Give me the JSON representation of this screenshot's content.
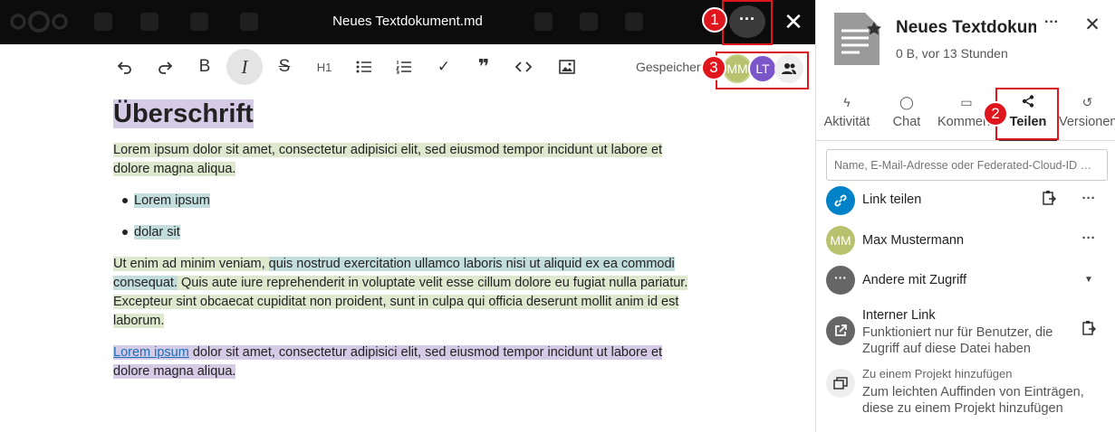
{
  "viewer": {
    "document_title": "Neues Textdokument.md",
    "more_label": "···",
    "close_label": "✕"
  },
  "toolbar": {
    "undo": "↶",
    "redo": "↷",
    "bold": "B",
    "italic": "I",
    "strike": "S",
    "heading": "H1",
    "bullet_list": "☰",
    "ordered_list": "≡",
    "checkbox": "✓",
    "quote": "❞",
    "code": "‹›",
    "image": "▣",
    "saved_status": "Gespeichert",
    "avatars": [
      {
        "initials": "MM",
        "color": "#b7c26e"
      },
      {
        "initials": "LT",
        "color": "#7b56c8"
      }
    ]
  },
  "document": {
    "heading": "Überschrift",
    "paragraph1": "Lorem ipsum dolor sit amet, consectetur adipisici elit, sed eiusmod tempor incidunt ut labore et dolore magna aliqua.",
    "list": [
      "Lorem ipsum",
      "dolar sit"
    ],
    "paragraph2_a": "Ut enim ad minim veniam, ",
    "paragraph2_b": "quis nostrud exercitation ullamco laboris nisi ut aliquid ex ea commodi consequat.",
    "paragraph2_c": " Quis aute iure reprehenderit in voluptate velit esse cillum dolore eu fugiat nulla pariatur. Excepteur sint obcaecat cupiditat non proident, sunt in culpa qui officia deserunt mollit anim id est laborum.",
    "paragraph3_link": "Lorem ipsum",
    "paragraph3_rest": " dolor sit amet, consectetur adipisici elit, sed eiusmod tempor incidunt ut labore et dolore magna aliqua."
  },
  "sidebar": {
    "file_name": "Neues Textdokument.md",
    "file_meta": "0 B, vor 13 Stunden",
    "more_label": "···",
    "close_label": "✕",
    "tabs": [
      {
        "icon": "ϟ",
        "label": "Aktivität"
      },
      {
        "icon": "◯",
        "label": "Chat"
      },
      {
        "icon": "▭",
        "label": "Kommentare"
      },
      {
        "icon": "<",
        "label": "Teilen",
        "active": true
      },
      {
        "icon": "↺",
        "label": "Versionen"
      }
    ],
    "share_placeholder": "Name, E-Mail-Adresse oder Federated-Cloud-ID …",
    "link_share": "Link teilen",
    "user": {
      "initials": "MM",
      "name": "Max Mustermann"
    },
    "others_access": "Andere mit Zugriff",
    "internal_link": {
      "title": "Interner Link",
      "desc": "Funktioniert nur für Benutzer, die Zugriff auf diese Datei haben"
    },
    "project": {
      "title": "Zu einem Projekt hinzufügen",
      "desc": "Zum leichten Auffinden von Einträgen, diese zu einem Projekt hinzufügen"
    }
  },
  "annotations": [
    "1",
    "2",
    "3"
  ],
  "colors": {
    "annotation_red": "#e0161e",
    "link_blue": "#0082c9",
    "highlight_purple": "#d6cbe6",
    "highlight_green": "#dde8cf",
    "highlight_teal": "#c3dddd"
  }
}
